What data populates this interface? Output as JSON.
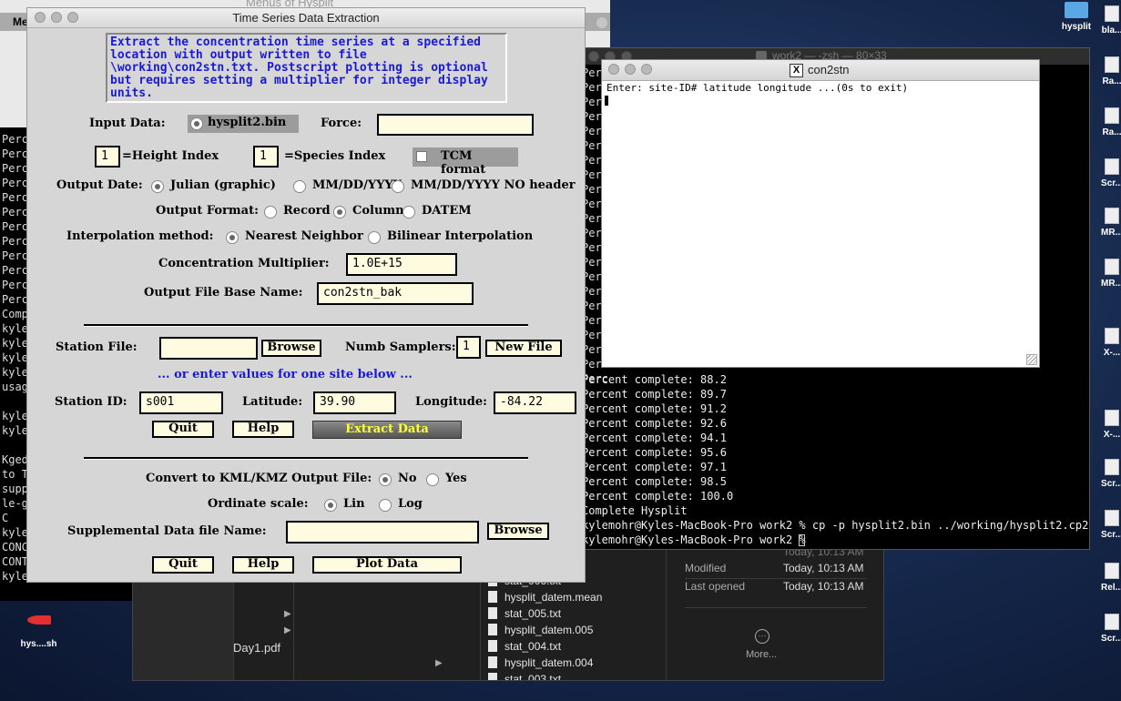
{
  "background_window": {
    "title": "Menus of Hysplit",
    "menu_fragment": "Me"
  },
  "left_terminal_lines": [
    "Perc",
    "Perc",
    "Perc",
    "Perc",
    "Perc",
    "Perc",
    "Perc",
    "Perc",
    "Perc",
    "Perc",
    "Perc",
    "Perc",
    "Comp",
    "kyle",
    "kyle",
    "kyle",
    "kyle",
    "usage",
    "",
    "kyle",
    "kyle",
    "",
    "Kgedf",
    "to Te",
    "suppl",
    "le-gv",
    "C",
    "kyle",
    "CONC.",
    "CONTR",
    "kylemohr@Kyles-MacBoo"
  ],
  "finder": {
    "sidebar_fragment": "Day1.pdf",
    "files": [
      "stat_006.txt",
      "hysplit_datem.mean",
      "stat_005.txt",
      "hysplit_datem.005",
      "stat_004.txt",
      "hysplit_datem.004",
      "stat_003.txt"
    ],
    "info": {
      "modified_label": "Modified",
      "modified_value": "Today, 10:13 AM",
      "opened_label": "Last opened",
      "opened_value": "Today, 10:13 AM",
      "more_label": "More...",
      "created_fragment": "Today, 10:13 AM"
    }
  },
  "desktop_icons": [
    {
      "label": "hysplit",
      "icon": "folder-icon"
    },
    {
      "label": "bla...",
      "icon": "file-icon"
    },
    {
      "label": "Ra...",
      "icon": "file-icon"
    },
    {
      "label": "Ra...",
      "icon": "file-icon"
    },
    {
      "label": "Scr...",
      "icon": "file-icon"
    },
    {
      "label": "MR...",
      "icon": "file-icon"
    },
    {
      "label": "MR...",
      "icon": "file-icon"
    },
    {
      "label": "X-...",
      "icon": "file-icon"
    },
    {
      "label": "X-...",
      "icon": "file-icon"
    },
    {
      "label": "Scr...",
      "icon": "file-icon"
    },
    {
      "label": "Scr...",
      "icon": "file-icon"
    },
    {
      "label": "Rel...",
      "icon": "file-icon"
    },
    {
      "label": "Scr...",
      "icon": "file-icon"
    }
  ],
  "hys_icon_label": "hys....sh",
  "zsh_window": {
    "title": "work2 — -zsh — 80×33",
    "left_lines": [
      "Perc",
      "Perc",
      "Perc",
      "Perc",
      "Perc",
      "Perc",
      "Perc",
      "Perc",
      "Perc",
      "Perc",
      "Perc",
      "Perc",
      "Perc",
      "Perc",
      "Perc",
      "Perc",
      "Perc",
      "Perc",
      "Perc",
      "Perc",
      "Perc",
      "Perc"
    ],
    "lines": [
      "Percent complete:  88.2",
      "Percent complete:  89.7",
      "Percent complete:  91.2",
      "Percent complete:  92.6",
      "Percent complete:  94.1",
      "Percent complete:  95.6",
      "Percent complete:  97.1",
      "Percent complete:  98.5",
      "Percent complete: 100.0",
      "Complete Hysplit",
      "kylemohr@Kyles-MacBook-Pro work2 % cp -p hysplit2.bin ../working/hysplit2.cp2",
      "kylemohr@Kyles-MacBook-Pro work2 % "
    ]
  },
  "xterm": {
    "title": "con2stn",
    "prompt": "Enter: site-ID# latitude longitude ...(0s to exit)"
  },
  "dialog": {
    "title": "Time Series Data Extraction",
    "description": "Extract the concentration time series at a specified location with output written to file \\working\\con2stn.txt.  Postscript plotting is optional but requires setting a multiplier for integer display units.",
    "input_data_label": "Input Data:",
    "input_data_value": "hysplit2.bin",
    "force_label": "Force:",
    "force_value": "",
    "height_index": "1",
    "height_index_label": "=Height Index",
    "species_index": "1",
    "species_index_label": "=Species Index",
    "tcm_label": "TCM format",
    "output_date_label": "Output Date:",
    "output_date_options": [
      "Julian (graphic)",
      "MM/DD/YYYY",
      "MM/DD/YYYY NO header"
    ],
    "output_format_label": "Output Format:",
    "output_format_options": [
      "Record",
      "Column",
      "DATEM"
    ],
    "interp_label": "Interpolation method:",
    "interp_options": [
      "Nearest Neighbor",
      "Bilinear Interpolation"
    ],
    "multiplier_label": "Concentration Multiplier:",
    "multiplier_value": "1.0E+15",
    "base_name_label": "Output File Base Name:",
    "base_name_value": "con2stn_bak",
    "station_file_label": "Station File:",
    "station_file_value": "",
    "browse_label": "Browse",
    "numb_samplers_label": "Numb Samplers:",
    "numb_samplers_value": "1",
    "new_file_label": "New File",
    "or_enter_label": "... or enter values for one site below ...",
    "station_id_label": "Station ID:",
    "station_id_value": "s001",
    "latitude_label": "Latitude:",
    "latitude_value": "39.90",
    "longitude_label": "Longitude:",
    "longitude_value": "-84.22",
    "quit_label": "Quit",
    "help_label": "Help",
    "extract_label": "Extract Data",
    "kml_label": "Convert to KML/KMZ Output File:",
    "kml_options": [
      "No",
      "Yes"
    ],
    "ordinate_label": "Ordinate scale:",
    "ordinate_options": [
      "Lin",
      "Log"
    ],
    "supp_label": "Supplemental Data file Name:",
    "supp_value": "",
    "browse2_label": "Browse",
    "quit2_label": "Quit",
    "help2_label": "Help",
    "plot_label": "Plot Data"
  }
}
